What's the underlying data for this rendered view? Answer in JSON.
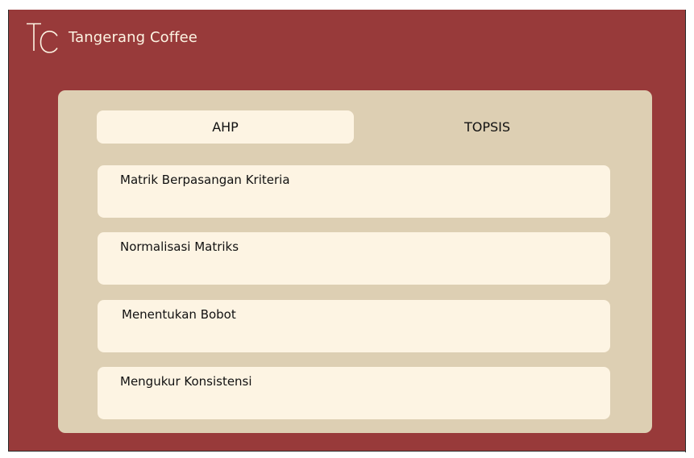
{
  "app": {
    "brand_name": "Tangerang Coffee",
    "logo_letters": "TC",
    "logo_icon": "tc-monogram-icon"
  },
  "tabs": [
    {
      "label": "AHP",
      "active": true
    },
    {
      "label": "TOPSIS",
      "active": false
    }
  ],
  "steps": [
    {
      "label": "Matrik Berpasangan Kriteria"
    },
    {
      "label": "Normalisasi Matriks"
    },
    {
      "label": "Menentukan Bobot"
    },
    {
      "label": "Mengukur Konsistensi"
    }
  ],
  "colors": {
    "header_background": "#983a3a",
    "panel_background": "#ddcfb3",
    "card_background": "#fdf4e3",
    "text_light": "#fdf4e3",
    "text_dark": "#111111"
  }
}
